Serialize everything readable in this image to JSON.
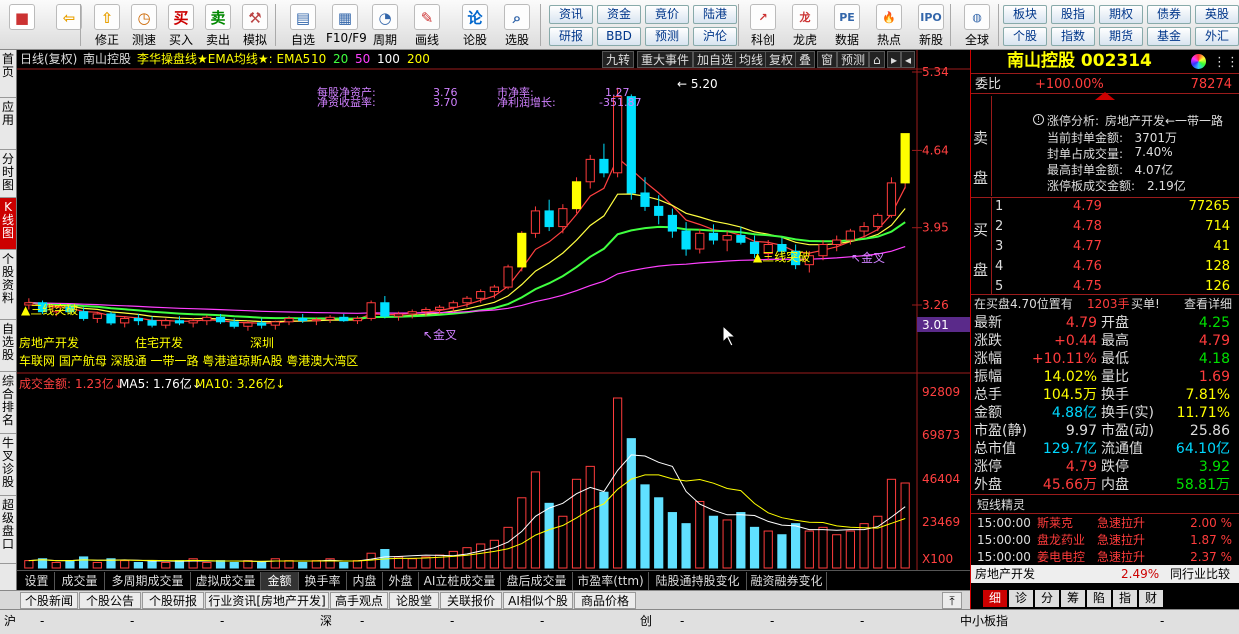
{
  "toolbar": {
    "buttons": [
      {
        "label": "",
        "icon": "windows-logo-icon"
      },
      {
        "label": "",
        "icon": "back-arrow-icon"
      },
      {
        "label": "修正",
        "icon": "up-arrow-icon"
      },
      {
        "label": "测速",
        "icon": "clock-icon"
      },
      {
        "label": "买入",
        "icon": "buy-icon",
        "glyph": "买"
      },
      {
        "label": "卖出",
        "icon": "sell-icon",
        "glyph": "卖"
      },
      {
        "label": "模拟",
        "icon": "hammer-icon"
      },
      {
        "label": "自选",
        "icon": "watchlist-icon"
      },
      {
        "label": "F10/F9",
        "icon": "f10-icon"
      },
      {
        "label": "周期",
        "icon": "period-icon"
      },
      {
        "label": "画线",
        "icon": "pencil-icon"
      },
      {
        "label": "论股",
        "icon": "forum-icon"
      },
      {
        "label": "选股",
        "icon": "search-chart-icon"
      }
    ],
    "small_buttons_row1": [
      "资讯",
      "资金",
      "竟价",
      "陆港"
    ],
    "small_buttons_row2": [
      "研报",
      "BBD",
      "预测",
      "沪伦"
    ],
    "buttons2": [
      {
        "label": "科创",
        "icon": "kechuang-icon"
      },
      {
        "label": "龙虎",
        "icon": "dragon-tiger-icon"
      },
      {
        "label": "数据",
        "icon": "pe-data-icon",
        "glyph": "PE"
      },
      {
        "label": "热点",
        "icon": "hot-icon"
      },
      {
        "label": "新股",
        "icon": "ipo-icon"
      },
      {
        "label": "全球",
        "icon": "globe-icon"
      }
    ],
    "right_row1": [
      "板块",
      "股指",
      "期权",
      "债券",
      "英股"
    ],
    "right_row2": [
      "个股",
      "指数",
      "期货",
      "基金",
      "外汇"
    ]
  },
  "left_tabs": [
    "首页",
    "应用",
    "分时图",
    "K线图",
    "个股资料",
    "自选股",
    "综合排名",
    "牛叉诊股",
    "超级盘口"
  ],
  "chart": {
    "header_left": "日线(复权)",
    "stock_name": "南山控股",
    "indicator_name": "李华操盘线",
    "ema_label": "★EMA均线★: EMA5",
    "ema_periods": [
      "10",
      "20",
      "50",
      "100",
      "200"
    ],
    "header_buttons": [
      "九转",
      "重大事件",
      "加自选",
      "均线",
      "复权",
      "叠",
      "窗",
      "预测"
    ],
    "info": {
      "nav_label": "每股净资产:",
      "nav_value": "3.76",
      "roe_label": "净资收益率:",
      "roe_value": "3.70",
      "pb_label": "市净率:",
      "pb_value": "1.27",
      "profit_label": "净利润增长:",
      "profit_value": "-351.87"
    },
    "price_axis": [
      "5.34",
      "4.64",
      "3.95",
      "3.26"
    ],
    "current_price_tag": "3.01",
    "annotations": {
      "high_mark": "5.20",
      "sanxian1": "三线突破",
      "sanxian2": "三线突破",
      "jincha1": "金叉",
      "jincha2": "金叉",
      "concept_line1": [
        "房地产开发",
        "住宅开发",
        "深圳"
      ],
      "concept_line2": "车联网 国产航母 深股通 一带一路 粤港道琼斯A股 粤港澳大湾区"
    },
    "volume_header": {
      "amount_label": "成交金额:",
      "amount_value": "1.23亿",
      "ma5": "MA5: 1.76亿",
      "ma10": "MA10: 3.26亿"
    },
    "volume_axis": [
      "92809",
      "69873",
      "46404",
      "23469",
      "X100"
    ]
  },
  "chart_data": {
    "type": "candlestick",
    "title": "南山控股 日线(复权)",
    "ylim": [
      3.01,
      5.34
    ],
    "candles": [
      [
        3.26,
        3.32,
        3.22,
        3.28
      ],
      [
        3.28,
        3.3,
        3.18,
        3.2
      ],
      [
        3.2,
        3.26,
        3.16,
        3.24
      ],
      [
        3.24,
        3.27,
        3.18,
        3.2
      ],
      [
        3.2,
        3.24,
        3.12,
        3.14
      ],
      [
        3.14,
        3.2,
        3.1,
        3.18
      ],
      [
        3.18,
        3.2,
        3.08,
        3.1
      ],
      [
        3.1,
        3.16,
        3.06,
        3.14
      ],
      [
        3.14,
        3.18,
        3.08,
        3.12
      ],
      [
        3.12,
        3.16,
        3.06,
        3.08
      ],
      [
        3.08,
        3.14,
        3.05,
        3.12
      ],
      [
        3.12,
        3.16,
        3.08,
        3.1
      ],
      [
        3.1,
        3.14,
        3.06,
        3.12
      ],
      [
        3.12,
        3.17,
        3.08,
        3.15
      ],
      [
        3.15,
        3.18,
        3.09,
        3.11
      ],
      [
        3.11,
        3.14,
        3.05,
        3.07
      ],
      [
        3.07,
        3.12,
        3.03,
        3.1
      ],
      [
        3.1,
        3.14,
        3.05,
        3.08
      ],
      [
        3.08,
        3.12,
        3.04,
        3.11
      ],
      [
        3.11,
        3.16,
        3.08,
        3.14
      ],
      [
        3.14,
        3.18,
        3.1,
        3.12
      ],
      [
        3.12,
        3.15,
        3.08,
        3.13
      ],
      [
        3.13,
        3.17,
        3.1,
        3.15
      ],
      [
        3.15,
        3.18,
        3.11,
        3.12
      ],
      [
        3.12,
        3.16,
        3.09,
        3.14
      ],
      [
        3.14,
        3.3,
        3.12,
        3.28
      ],
      [
        3.28,
        3.34,
        3.14,
        3.16
      ],
      [
        3.16,
        3.2,
        3.12,
        3.18
      ],
      [
        3.18,
        3.22,
        3.14,
        3.2
      ],
      [
        3.2,
        3.24,
        3.16,
        3.22
      ],
      [
        3.22,
        3.26,
        3.18,
        3.24
      ],
      [
        3.24,
        3.3,
        3.2,
        3.28
      ],
      [
        3.28,
        3.34,
        3.24,
        3.32
      ],
      [
        3.32,
        3.4,
        3.28,
        3.38
      ],
      [
        3.38,
        3.44,
        3.32,
        3.42
      ],
      [
        3.42,
        3.62,
        3.4,
        3.6
      ],
      [
        3.6,
        3.92,
        3.56,
        3.9
      ],
      [
        3.9,
        4.14,
        3.86,
        4.1
      ],
      [
        4.1,
        4.2,
        3.92,
        3.96
      ],
      [
        3.96,
        4.16,
        3.9,
        4.12
      ],
      [
        4.12,
        4.4,
        4.08,
        4.36
      ],
      [
        4.36,
        4.6,
        4.3,
        4.56
      ],
      [
        4.56,
        4.7,
        4.4,
        4.44
      ],
      [
        4.44,
        5.2,
        4.4,
        5.12
      ],
      [
        5.12,
        5.14,
        4.2,
        4.26
      ],
      [
        4.26,
        4.4,
        4.1,
        4.14
      ],
      [
        4.14,
        4.24,
        3.98,
        4.06
      ],
      [
        4.06,
        4.12,
        3.86,
        3.92
      ],
      [
        3.92,
        4.0,
        3.7,
        3.76
      ],
      [
        3.76,
        3.94,
        3.72,
        3.9
      ],
      [
        3.9,
        3.98,
        3.8,
        3.84
      ],
      [
        3.84,
        3.92,
        3.74,
        3.88
      ],
      [
        3.88,
        3.96,
        3.8,
        3.82
      ],
      [
        3.82,
        3.88,
        3.68,
        3.72
      ],
      [
        3.72,
        3.84,
        3.66,
        3.8
      ],
      [
        3.8,
        3.86,
        3.7,
        3.74
      ],
      [
        3.74,
        3.8,
        3.58,
        3.62
      ],
      [
        3.62,
        3.74,
        3.55,
        3.7
      ],
      [
        3.7,
        3.84,
        3.66,
        3.8
      ],
      [
        3.8,
        3.88,
        3.74,
        3.84
      ],
      [
        3.84,
        3.94,
        3.8,
        3.92
      ],
      [
        3.92,
        4.0,
        3.86,
        3.96
      ],
      [
        3.96,
        4.08,
        3.92,
        4.06
      ],
      [
        4.06,
        4.4,
        4.04,
        4.35
      ],
      [
        4.35,
        4.79,
        4.3,
        4.79
      ]
    ],
    "ma_series": [
      {
        "name": "EMA5",
        "color": "#ff4040"
      },
      {
        "name": "EMA10",
        "color": "#ffff40"
      },
      {
        "name": "EMA20",
        "color": "#40ff40"
      },
      {
        "name": "EMA50",
        "color": "#ff40ff"
      }
    ],
    "volume": [
      4,
      5,
      3,
      4,
      6,
      3,
      5,
      4,
      3,
      4,
      3,
      4,
      5,
      3,
      4,
      3,
      4,
      3,
      5,
      4,
      3,
      4,
      5,
      3,
      4,
      8,
      10,
      6,
      5,
      6,
      7,
      9,
      11,
      13,
      15,
      22,
      38,
      52,
      35,
      28,
      48,
      55,
      41,
      92,
      70,
      45,
      38,
      30,
      24,
      36,
      28,
      26,
      30,
      22,
      20,
      18,
      24,
      20,
      22,
      18,
      20,
      24,
      28,
      48,
      46
    ],
    "volume_ylim": [
      0,
      92809
    ]
  },
  "bottom_tabs": [
    "设置",
    "成交量",
    "多周期成交量",
    "虚拟成交量",
    "金额",
    "换手率",
    "内盘",
    "外盘",
    "AI立桩成交量",
    "盘后成交量",
    "市盈率(ttm)",
    "陆股通持股变化",
    "融资融券变化"
  ],
  "bottom_tabs_active": "金额",
  "bottom_tabs2": [
    "个股新闻",
    "个股公告",
    "个股研报",
    "行业资讯[房地产开发]",
    "高手观点",
    "论股堂",
    "关联报价",
    "AI相似个股",
    "商品价格"
  ],
  "right_panel": {
    "title": "南山控股 002314",
    "weibi_label": "委比",
    "weibi_value": "+100.00%",
    "weibi_diff": "78274",
    "sell_label": "卖盘",
    "limit_title": "涨停分析:",
    "limit_sector": "房地产开发←一带一路",
    "limit_lines": [
      {
        "label": "当前封单金额:",
        "value": "3701万"
      },
      {
        "label": "封单占成交量:",
        "value": "7.40%"
      },
      {
        "label": "最高封单金额:",
        "value": "4.07亿"
      },
      {
        "label": "涨停板成交金额:",
        "value": "2.19亿"
      }
    ],
    "buy_label": "买盘",
    "buy_levels": [
      {
        "level": "1",
        "price": "4.79",
        "vol": "77265"
      },
      {
        "level": "2",
        "price": "4.78",
        "vol": "714"
      },
      {
        "level": "3",
        "price": "4.77",
        "vol": "41"
      },
      {
        "level": "4",
        "price": "4.76",
        "vol": "128"
      },
      {
        "level": "5",
        "price": "4.75",
        "vol": "126"
      }
    ],
    "pending_text": "在买盘4.70位置有",
    "pending_vol": "1203手",
    "pending_action": "买单!",
    "detail_link": "查看详细",
    "quote": [
      {
        "l1": "最新",
        "v1": "4.79",
        "c1": "red",
        "l2": "开盘",
        "v2": "4.25",
        "c2": "green"
      },
      {
        "l1": "涨跌",
        "v1": "+0.44",
        "c1": "red",
        "l2": "最高",
        "v2": "4.79",
        "c2": "red"
      },
      {
        "l1": "涨幅",
        "v1": "+10.11%",
        "c1": "red",
        "l2": "最低",
        "v2": "4.18",
        "c2": "green"
      },
      {
        "l1": "振幅",
        "v1": "14.02%",
        "c1": "yellow",
        "l2": "量比",
        "v2": "1.69",
        "c2": "red"
      },
      {
        "l1": "总手",
        "v1": "104.5万",
        "c1": "yellow",
        "l2": "换手",
        "v2": "7.81%",
        "c2": "yellow"
      },
      {
        "l1": "金额",
        "v1": "4.88亿",
        "c1": "cyan",
        "l2": "换手(实)",
        "v2": "11.71%",
        "c2": "yellow"
      },
      {
        "l1": "市盈(静)",
        "v1": "9.97",
        "c1": "white",
        "l2": "市盈(动)",
        "v2": "25.86",
        "c2": "white"
      },
      {
        "l1": "总市值",
        "v1": "129.7亿",
        "c1": "cyan",
        "l2": "流通值",
        "v2": "64.10亿",
        "c2": "cyan"
      },
      {
        "l1": "涨停",
        "v1": "4.79",
        "c1": "red",
        "l2": "跌停",
        "v2": "3.92",
        "c2": "green"
      },
      {
        "l1": "外盘",
        "v1": "45.66万",
        "c1": "red",
        "l2": "内盘",
        "v2": "58.81万",
        "c2": "green"
      }
    ],
    "short_title": "短线精灵",
    "short_items": [
      {
        "time": "15:00:00",
        "name": "斯莱克",
        "event": "急速拉升",
        "val": "2.00 %"
      },
      {
        "time": "15:00:00",
        "name": "盘龙药业",
        "event": "急速拉升",
        "val": "1.87 %"
      },
      {
        "time": "15:00:00",
        "name": "姜电电控",
        "event": "急速拉升",
        "val": "2.37 %"
      }
    ],
    "industry_name": "房地产开发",
    "industry_pct": "2.49%",
    "industry_compare": "同行业比较",
    "bottom_tabs": [
      "细",
      "诊",
      "分",
      "筹",
      "陷",
      "指",
      "财"
    ]
  },
  "statusbar": {
    "items": [
      "沪",
      "-",
      "-",
      "-",
      "深",
      "-",
      "-",
      "-",
      "创",
      "-",
      "-",
      "-",
      "中小板指",
      "-"
    ]
  },
  "colors": {
    "up": "#ff3c3c",
    "down": "#00e0ff",
    "accent": "#cc0000"
  }
}
